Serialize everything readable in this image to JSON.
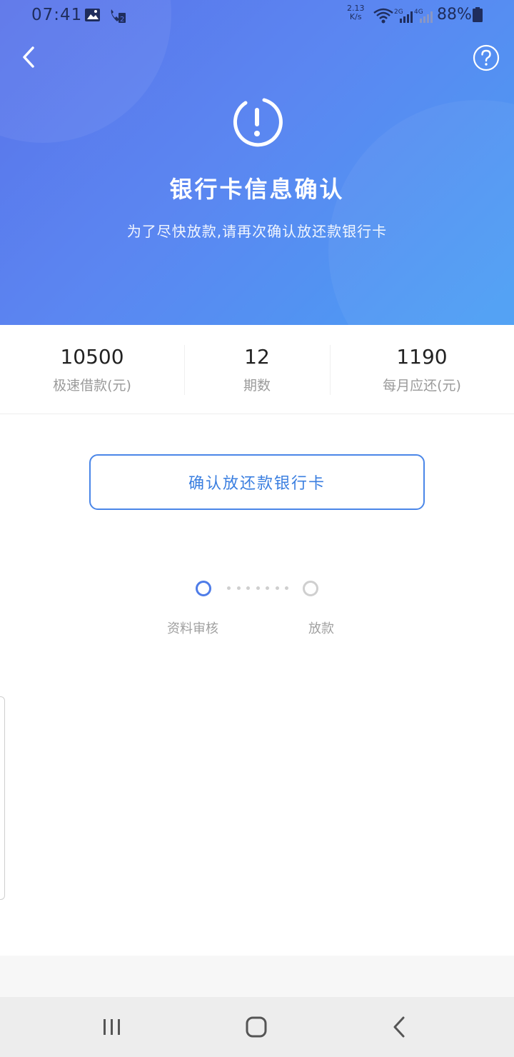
{
  "status_bar": {
    "time": "07:41",
    "speed_value": "2.13",
    "speed_unit": "K/s",
    "battery": "88%"
  },
  "header": {
    "title": "银行卡信息确认",
    "subtitle": "为了尽快放款,请再次确认放还款银行卡",
    "gradient_start": "#5a73e9",
    "gradient_end": "#4a9ff4"
  },
  "stats": [
    {
      "value": "10500",
      "label": "极速借款(元)"
    },
    {
      "value": "12",
      "label": "期数"
    },
    {
      "value": "1190",
      "label": "每月应还(元)"
    }
  ],
  "confirm_button": {
    "label": "确认放还款银行卡",
    "color": "#3b7fe0"
  },
  "progress": {
    "steps": [
      {
        "label": "资料审核",
        "state": "active"
      },
      {
        "label": "放款",
        "state": "inactive"
      }
    ]
  },
  "icons": {
    "back": "chevron-left-icon",
    "help": "question-circle-icon",
    "alert": "exclamation-circle-icon",
    "nav_recent": "recent-apps-icon",
    "nav_home": "home-icon",
    "nav_back": "nav-back-icon"
  }
}
